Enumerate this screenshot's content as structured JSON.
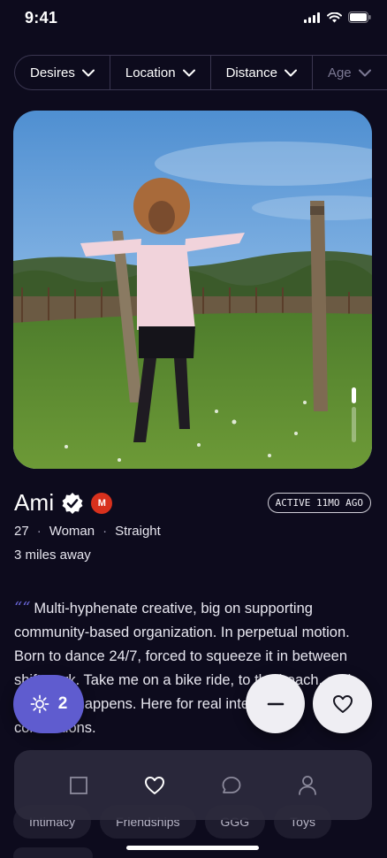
{
  "status_bar": {
    "time": "9:41",
    "icons": [
      "cellular-signal-icon",
      "wifi-icon",
      "battery-icon"
    ]
  },
  "filters": [
    {
      "label": "Desires",
      "icon": "chevron-down-icon"
    },
    {
      "label": "Location",
      "icon": "chevron-down-icon"
    },
    {
      "label": "Distance",
      "icon": "chevron-down-icon"
    },
    {
      "label": "Age",
      "icon": "chevron-down-icon"
    }
  ],
  "profile": {
    "name": "Ami",
    "verified_icon": "verified-check-icon",
    "badge_letter": "M",
    "active_status": "ACTIVE 11MO AGO",
    "age": "27",
    "gender": "Woman",
    "orientation": "Straight",
    "separator": "·",
    "distance": "3 miles away",
    "photo_count": 2,
    "photo_current": 1
  },
  "bio": {
    "quote_mark": "““",
    "text": "Multi-hyphenate creative, big on supporting community-based organization. In perpetual motion. Born to dance 24/7, forced to squeeze it in between shift work. Take me on a bike ride, to the beach, and see what happens. Here for real intentional connections."
  },
  "actions": {
    "superlike_icon": "sparkle-icon",
    "superlike_count": "2",
    "pass_icon": "minus-icon",
    "like_icon": "heart-outline-icon"
  },
  "tags": [
    "Intimacy",
    "Friendships",
    "GGG",
    "Toys"
  ],
  "bottom_nav": [
    {
      "name": "discover",
      "icon": "square-icon",
      "active": false
    },
    {
      "name": "likes",
      "icon": "heart-icon",
      "active": true
    },
    {
      "name": "messages",
      "icon": "chat-bubble-icon",
      "active": false
    },
    {
      "name": "profile",
      "icon": "person-icon",
      "active": false
    }
  ],
  "colors": {
    "background": "#0d0b1d",
    "accent": "#5f5ccf",
    "badge_red": "#d8311d",
    "nav_bg": "#2c2a3c"
  }
}
